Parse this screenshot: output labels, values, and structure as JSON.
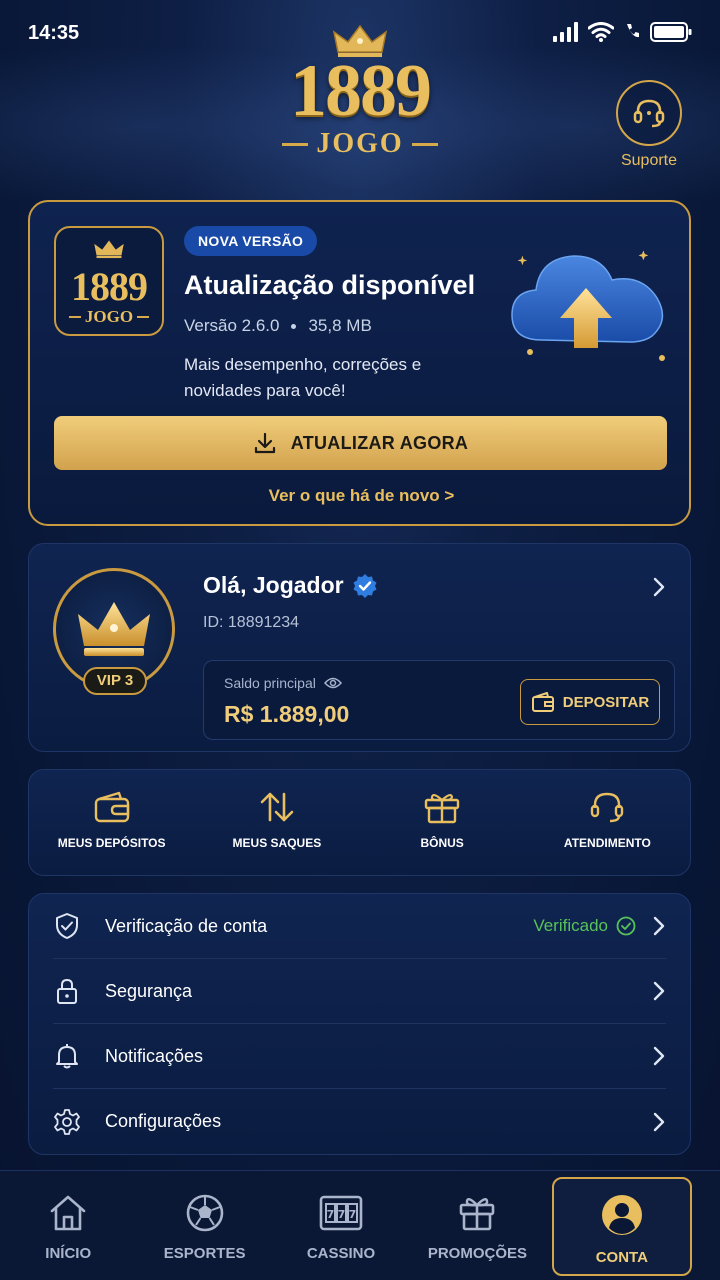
{
  "status_bar": {
    "time": "14:35"
  },
  "brand": {
    "logo_number": "1889",
    "logo_sub": "JOGO"
  },
  "header": {
    "support_label": "Suporte"
  },
  "update_card": {
    "badge": "NOVA VERSÃO",
    "title": "Atualização disponível",
    "version": "Versão 2.6.0",
    "size": "35,8 MB",
    "description": "Mais desempenho, correções e novidades para você!",
    "button_label": "ATUALIZAR AGORA",
    "whats_new_link": "Ver o que há de novo >"
  },
  "profile": {
    "greeting": "Olá, Jogador",
    "id_text": "ID: 18891234",
    "vip_label": "VIP 3",
    "balance_label": "Saldo principal",
    "balance_value": "R$ 1.889,00",
    "deposit_label": "DEPOSITAR"
  },
  "quick_actions": [
    {
      "label": "MEUS DEPÓSITOS",
      "icon": "wallet-icon"
    },
    {
      "label": "MEUS SAQUES",
      "icon": "transfer-arrows-icon"
    },
    {
      "label": "BÔNUS",
      "icon": "gift-icon"
    },
    {
      "label": "ATENDIMENTO",
      "icon": "headset-icon"
    }
  ],
  "menu": [
    {
      "label": "Verificação de conta",
      "icon": "shield-check-icon",
      "status": "Verificado"
    },
    {
      "label": "Segurança",
      "icon": "lock-icon"
    },
    {
      "label": "Notificações",
      "icon": "bell-icon"
    },
    {
      "label": "Configurações",
      "icon": "gear-icon"
    }
  ],
  "bottom_nav": [
    {
      "label": "INÍCIO",
      "icon": "home-icon",
      "active": false
    },
    {
      "label": "ESPORTES",
      "icon": "soccer-ball-icon",
      "active": false
    },
    {
      "label": "CASSINO",
      "icon": "slot-machine-icon",
      "active": false
    },
    {
      "label": "PROMOÇÕES",
      "icon": "gift-icon",
      "active": false
    },
    {
      "label": "CONTA",
      "icon": "user-icon",
      "active": true
    }
  ],
  "colors": {
    "gold": "#e8be5e",
    "background": "#0b1c41",
    "verified_green": "#58c25a",
    "badge_blue": "#1a4aa8"
  }
}
